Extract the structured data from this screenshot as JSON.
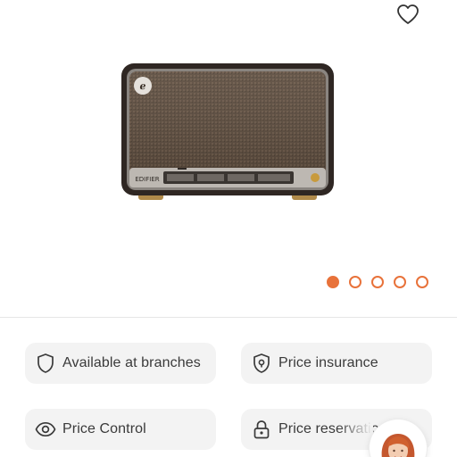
{
  "product": {
    "brand_plate": "EDIFIER",
    "favorite_icon": "heart-outline-icon"
  },
  "gallery": {
    "total_images": 5,
    "active_index": 0,
    "accent_color": "#e8723a"
  },
  "features": [
    {
      "label": "Available at branches",
      "icon": "shield-outline-icon"
    },
    {
      "label": "Price insurance",
      "icon": "shield-check-icon"
    },
    {
      "label": "Price Control",
      "icon": "eye-icon"
    },
    {
      "label": "Price reservation",
      "icon": "lock-icon"
    }
  ],
  "assistant": {
    "icon": "assistant-avatar"
  }
}
